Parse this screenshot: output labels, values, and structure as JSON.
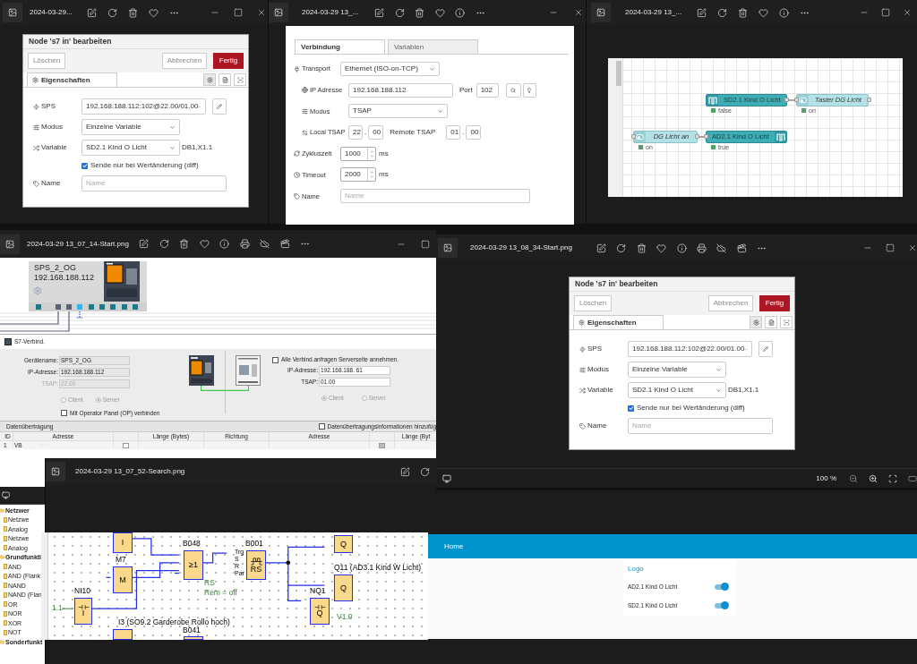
{
  "viewer_1": {
    "title": "2024-03-29...",
    "dialog": {
      "title": "Node 's7 in' bearbeiten",
      "buttons": {
        "delete": "Löschen",
        "cancel": "Abbrechen",
        "done": "Fertig"
      },
      "tab": "Eigenschaften",
      "fields": [
        {
          "kind": "select-edit",
          "label": "SPS",
          "value": "192.168.188.112:102@22.00/01.00"
        },
        {
          "kind": "select",
          "label": "Modus",
          "value": "Einzelne Variable"
        },
        {
          "kind": "select",
          "label": "Variable",
          "value": "SD2.1 Kind O Licht",
          "suffix": "DB1,X1.1"
        },
        {
          "kind": "checkbox",
          "label": "Sende nur bei Wertänderung (diff)",
          "checked": true
        },
        {
          "kind": "input",
          "label": "Name",
          "placeholder": "Name"
        }
      ]
    }
  },
  "viewer_2": {
    "title": "2024-03-29 13_...",
    "config": {
      "tabs": [
        {
          "label": "Verbindung",
          "selected": true
        },
        {
          "label": "Variablen",
          "selected": false
        }
      ],
      "transport": {
        "label": "Transport",
        "value": "Ethernet (ISO-on-TCP)"
      },
      "ip": {
        "label": "IP Adresse",
        "value": "192.168.188.112",
        "port_label": "Port",
        "port": "102"
      },
      "mode": {
        "label": "Modus",
        "value": "TSAP"
      },
      "local_tsap": {
        "label": "Local TSAP",
        "values": [
          "22",
          "00"
        ],
        "separator": "."
      },
      "remote_tsap": {
        "label": "Remote TSAP",
        "values": [
          "01",
          "00"
        ],
        "separator": "."
      },
      "cycle": {
        "label": "Zykluszeit",
        "value": "1000",
        "unit": "ms"
      },
      "timeout": {
        "label": "Timeout",
        "value": "2000",
        "unit": "ms"
      },
      "name": {
        "label": "Name",
        "placeholder": "Name"
      }
    }
  },
  "viewer_3": {
    "title": "2024-03-29 13_...",
    "flow_nodes": [
      {
        "kind": "s7-in",
        "label": "SD2.1 Kind O Licht",
        "status": "false"
      },
      {
        "kind": "switch",
        "label": "Taster DG Licht",
        "status": "on"
      },
      {
        "kind": "switch",
        "label": "DG Licht an",
        "status": "on"
      },
      {
        "kind": "s7-out",
        "label": "AD2.1 Kind O Licht",
        "status": "true"
      }
    ]
  },
  "viewer_4": {
    "title": "2024-03-29 13_07_14-Start.png",
    "device": {
      "name": "SPS_2_OG",
      "ip": "192.168.188.112"
    },
    "s7": {
      "title": "S7-Verbind.",
      "local": {
        "fields": [
          {
            "label": "Gerätename:",
            "value": "SPS_2_OG",
            "disabled": false
          },
          {
            "label": "IP-Adresse:",
            "value": "192.168.188.112",
            "disabled": false
          },
          {
            "label": "TSAP:",
            "value": "22.00",
            "disabled": true
          }
        ],
        "radios": [
          {
            "label": "Client",
            "selected": false
          },
          {
            "label": "Server",
            "selected": true
          }
        ],
        "op_checkbox": {
          "label": "Mit Operator Panel (OP) verbinden",
          "checked": false
        }
      },
      "remote": {
        "accept_all": {
          "label": "Alle Verbind.anfragen Serverseite annehmen.",
          "checked": false
        },
        "fields": [
          {
            "label": "IP-Adresse:",
            "value": "192.168.188. 61"
          },
          {
            "label": "TSAP:",
            "value": "01.00"
          }
        ],
        "radios": [
          {
            "label": "Client",
            "selected": true
          },
          {
            "label": "Server",
            "selected": false
          }
        ]
      },
      "transfer": {
        "title": "Datenübertragung",
        "info_checkbox": {
          "label": "Datenübertragungsinformationen hinzufüg",
          "checked": false
        },
        "columns": [
          "ID",
          "Adresse",
          "Länge (Bytes)",
          "Richtung",
          "Adresse",
          "Länge (Byt"
        ],
        "rows": [
          [
            "1",
            "VB"
          ]
        ]
      }
    },
    "palette": [
      {
        "label": "Netzwer",
        "children": [
          {
            "label": "Netzwe"
          },
          {
            "label": "Analog"
          },
          {
            "label": "Netzwe"
          },
          {
            "label": "Analog"
          }
        ]
      },
      {
        "label": "Grundfunkti",
        "children": [
          {
            "label": "AND"
          },
          {
            "label": "AND (Flank"
          },
          {
            "label": "NAND"
          },
          {
            "label": "NAND (Flan"
          },
          {
            "label": "OR"
          },
          {
            "label": "NOR"
          },
          {
            "label": "XOR"
          },
          {
            "label": "NOT"
          }
        ]
      },
      {
        "label": "Sonderfunkt"
      }
    ]
  },
  "viewer_5": {
    "title": "2024-03-29 13_08_34-Start.png",
    "dialog": {
      "title": "Node 's7 in' bearbeiten",
      "buttons": {
        "delete": "Löschen",
        "cancel": "Abbrechen",
        "done": "Fertig"
      },
      "tab": "Eigenschaften",
      "fields": [
        {
          "kind": "select-edit",
          "label": "SPS",
          "value": "192.168.188.112:102@22.00/01.00"
        },
        {
          "kind": "select",
          "label": "Modus",
          "value": "Einzelne Variable"
        },
        {
          "kind": "select",
          "label": "Variable",
          "value": "SD2.1 Kind O Licht",
          "suffix": "DB1,X1.1"
        },
        {
          "kind": "checkbox",
          "label": "Sende nur bei Wertänderung (diff)",
          "checked": true
        },
        {
          "kind": "input",
          "label": "Name",
          "placeholder": "Name"
        }
      ]
    },
    "zoom": "100 %"
  },
  "viewer_6": {
    "title": "2024-03-29 13_07_52-Search.png",
    "diagram": {
      "blocks": [
        {
          "symbol": "I"
        },
        {
          "name": "B048",
          "symbol": "≥1"
        },
        {
          "name": "B001",
          "symbol": "RS",
          "pins": [
            "Trg",
            "S",
            "R",
            "Par"
          ]
        },
        {
          "symbol": "Q"
        },
        {
          "name": "M7",
          "symbol": "M"
        },
        {
          "name": "Q11  (AD3.1 Kind W Licht)",
          "symbol": "Q"
        },
        {
          "name": "NI10",
          "symbol": "I"
        },
        {
          "name": "NQ1",
          "symbol": "Q"
        },
        {
          "name": "I3 (SO9.2 Garderobe Rollo hoch)"
        },
        {
          "name": "B041"
        }
      ],
      "notes": [
        "RS",
        "Rem = off",
        "1.1",
        "V1.0"
      ]
    }
  },
  "dashboard": {
    "header": "Home",
    "card": {
      "title": "Logo",
      "switches": [
        {
          "label": "AD2.1 Kind O Licht",
          "on": true
        },
        {
          "label": "SD2.1 Kind O Licht",
          "on": true
        }
      ]
    }
  }
}
